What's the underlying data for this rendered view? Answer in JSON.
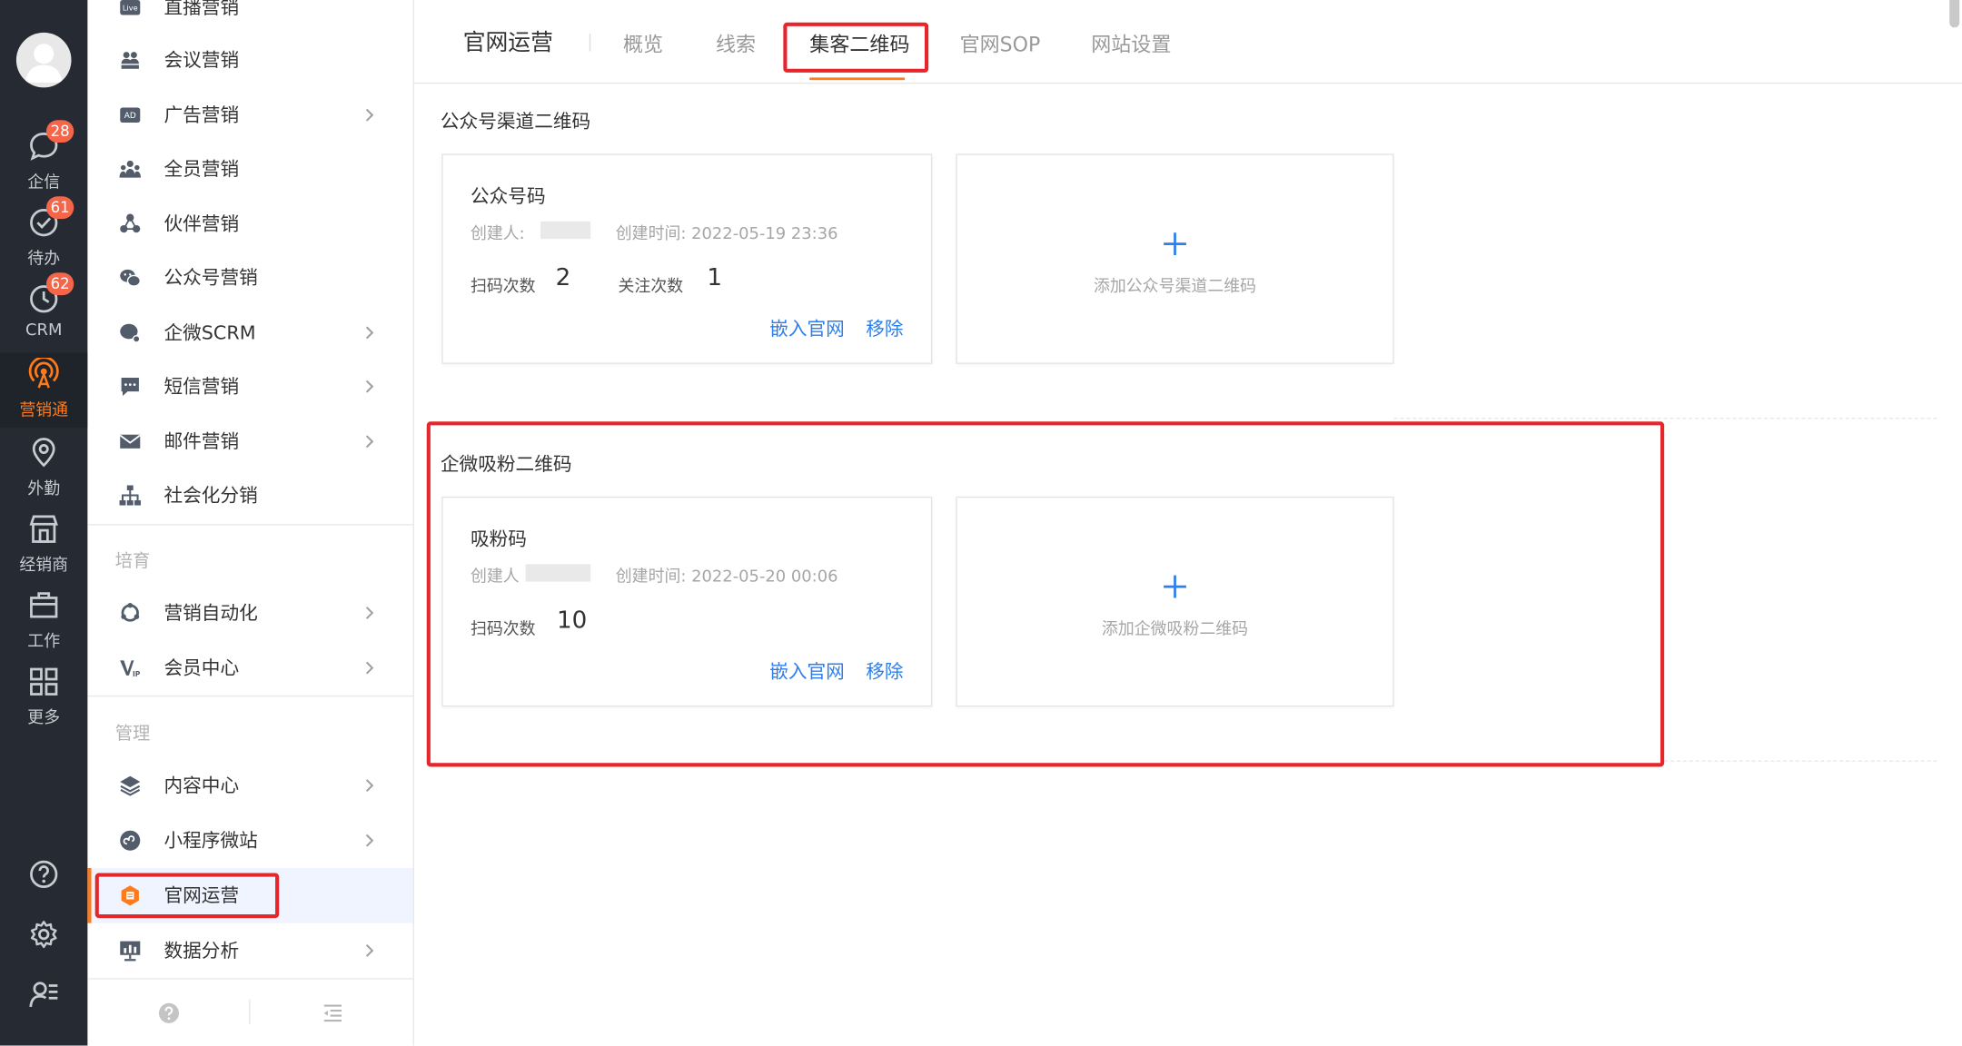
{
  "rail": {
    "items": [
      {
        "label": "企信",
        "badge": "28",
        "icon": "chat-bubble-icon"
      },
      {
        "label": "待办",
        "badge": "61",
        "icon": "check-circle-icon"
      },
      {
        "label": "CRM",
        "badge": "62",
        "icon": "clock-icon"
      },
      {
        "label": "营销通",
        "badge": "",
        "icon": "broadcast-icon",
        "active": true
      },
      {
        "label": "外勤",
        "badge": "",
        "icon": "location-pin-icon"
      },
      {
        "label": "经销商",
        "badge": "",
        "icon": "storefront-icon"
      },
      {
        "label": "工作",
        "badge": "",
        "icon": "briefcase-icon"
      },
      {
        "label": "更多",
        "badge": "",
        "icon": "grid-icon"
      }
    ],
    "utilities": [
      "help-icon",
      "settings-gear-icon",
      "user-list-icon"
    ]
  },
  "menu": {
    "items": [
      {
        "label": "直播营销",
        "icon": "live-icon",
        "has_arrow": false
      },
      {
        "label": "会议营销",
        "icon": "meeting-icon",
        "has_arrow": false
      },
      {
        "label": "广告营销",
        "icon": "ad-icon",
        "has_arrow": true
      },
      {
        "label": "全员营销",
        "icon": "team-icon",
        "has_arrow": false
      },
      {
        "label": "伙伴营销",
        "icon": "partner-icon",
        "has_arrow": false
      },
      {
        "label": "公众号营销",
        "icon": "wechat-icon",
        "has_arrow": false
      },
      {
        "label": "企微SCRM",
        "icon": "wecom-icon",
        "has_arrow": true
      },
      {
        "label": "短信营销",
        "icon": "sms-icon",
        "has_arrow": true
      },
      {
        "label": "邮件营销",
        "icon": "mail-icon",
        "has_arrow": true
      },
      {
        "label": "社会化分销",
        "icon": "org-chart-icon",
        "has_arrow": false
      }
    ],
    "section_nurture": "培育",
    "nurture_items": [
      {
        "label": "营销自动化",
        "icon": "automation-icon",
        "has_arrow": true
      },
      {
        "label": "会员中心",
        "icon": "vip-icon",
        "has_arrow": true
      }
    ],
    "section_manage": "管理",
    "manage_items": [
      {
        "label": "内容中心",
        "icon": "layers-icon",
        "has_arrow": true
      },
      {
        "label": "小程序微站",
        "icon": "mini-program-icon",
        "has_arrow": true
      },
      {
        "label": "官网运营",
        "icon": "website-icon",
        "has_arrow": false,
        "active": true
      },
      {
        "label": "数据分析",
        "icon": "analytics-icon",
        "has_arrow": true
      }
    ]
  },
  "tabs": {
    "title": "官网运营",
    "items": [
      "概览",
      "线索",
      "集客二维码",
      "官网SOP",
      "网站设置"
    ],
    "active_index": 2
  },
  "sections": [
    {
      "title": "公众号渠道二维码",
      "card": {
        "name": "公众号码",
        "creator_label": "创建人:",
        "created_time": "创建时间: 2022-05-19 23:36",
        "stats": [
          {
            "label": "扫码次数",
            "value": "2"
          },
          {
            "label": "关注次数",
            "value": "1"
          }
        ],
        "embed_link": "嵌入官网",
        "remove_link": "移除"
      },
      "add_label": "添加公众号渠道二维码"
    },
    {
      "title": "企微吸粉二维码",
      "card": {
        "name": "吸粉码",
        "creator_label": "创建人",
        "created_time": "创建时间: 2022-05-20 00:06",
        "stats": [
          {
            "label": "扫码次数",
            "value": "10"
          }
        ],
        "embed_link": "嵌入官网",
        "remove_link": "移除"
      },
      "add_label": "添加企微吸粉二维码"
    }
  ],
  "colors": {
    "accent": "#ff7a1a",
    "link": "#2d7ff0",
    "highlight": "#e6262b",
    "badge": "#f5654a",
    "rail_bg": "#262b33"
  }
}
